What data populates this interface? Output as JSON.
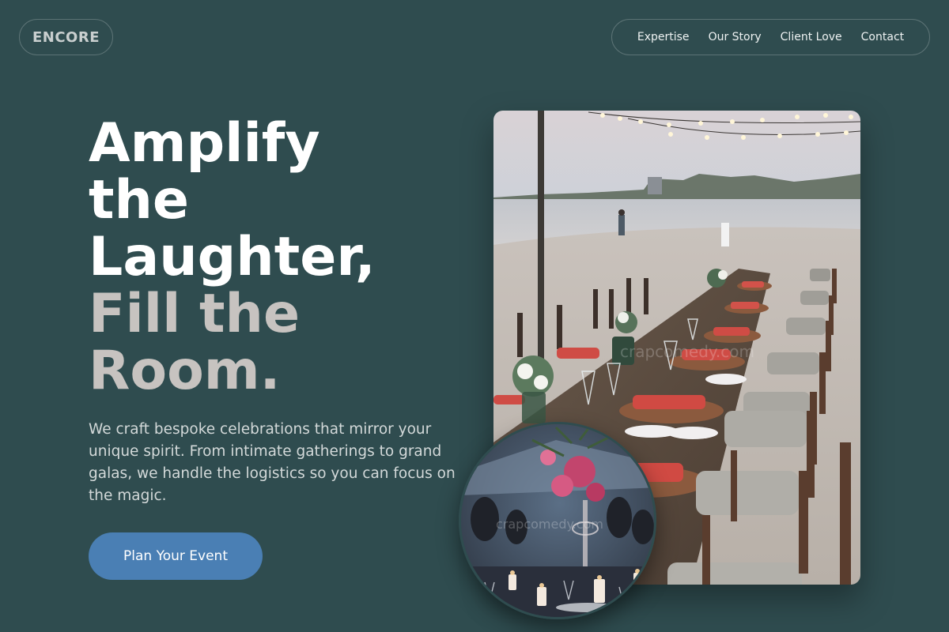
{
  "brand": {
    "logo": "ENCORE"
  },
  "nav": {
    "items": [
      {
        "label": "Expertise"
      },
      {
        "label": "Our Story"
      },
      {
        "label": "Client Love"
      },
      {
        "label": "Contact"
      }
    ]
  },
  "hero": {
    "headline_lines": [
      "Amplify",
      "the",
      "Laughter,",
      "Fill the",
      "Room."
    ],
    "lead": "We craft bespoke celebrations that mirror your unique spirit. From intimate gatherings to grand galas, we handle the logistics so you can focus on the magic.",
    "cta_label": "Plan Your Event"
  },
  "images": {
    "main": {
      "subject": "beach-dinner-long-table-photo",
      "watermark": "crapcomedy.com"
    },
    "circle": {
      "subject": "candlelit-banquet-photo",
      "watermark": "crapcomedy.com"
    }
  },
  "colors": {
    "background": "#2f4c4f",
    "accent": "#4a7fb4",
    "headline_primary": "#ffffff",
    "headline_secondary": "#c7c3c0"
  }
}
